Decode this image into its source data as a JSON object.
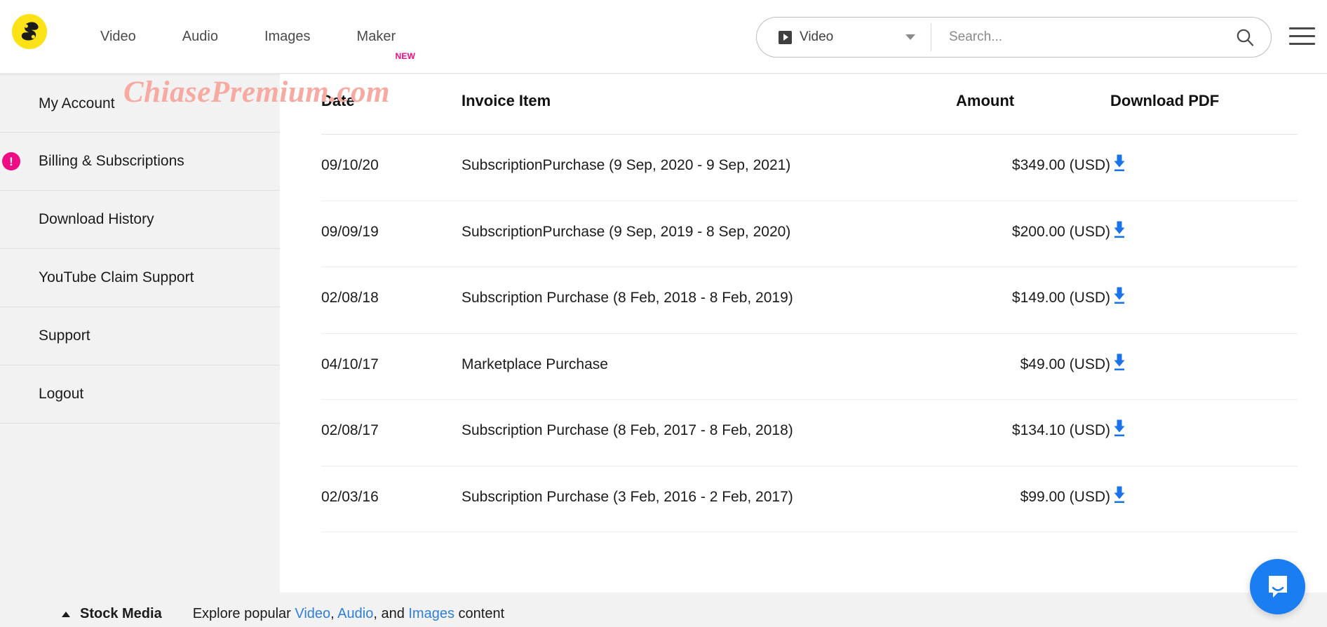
{
  "header": {
    "logo_name": "storyblocks-logo",
    "nav": [
      {
        "label": "Video",
        "badge": ""
      },
      {
        "label": "Audio",
        "badge": ""
      },
      {
        "label": "Images",
        "badge": ""
      },
      {
        "label": "Maker",
        "badge": "NEW"
      }
    ],
    "search": {
      "category_selected": "Video",
      "placeholder": "Search...",
      "search_icon": "search-icon",
      "caret_icon": "chevron-down-icon"
    },
    "menu_icon": "hamburger-menu-icon"
  },
  "watermark": {
    "text": "ChiasePremium.com",
    "color": "#f6aaa1"
  },
  "sidebar": {
    "items": [
      {
        "label": "My Account",
        "alert": ""
      },
      {
        "label": "Billing & Subscriptions",
        "alert": "!"
      },
      {
        "label": "Download History",
        "alert": ""
      },
      {
        "label": "YouTube Claim Support",
        "alert": ""
      },
      {
        "label": "Support",
        "alert": ""
      },
      {
        "label": "Logout",
        "alert": ""
      }
    ],
    "alert_color": "#ef0b84"
  },
  "invoices_table": {
    "columns": [
      "Date",
      "Invoice Item",
      "Amount",
      "Download PDF"
    ],
    "download_icon": "download-arrow-icon",
    "rows": [
      {
        "date": "09/10/20",
        "item": "SubscriptionPurchase (9 Sep, 2020 - 9 Sep, 2021)",
        "amount": "$349.00 (USD)"
      },
      {
        "date": "09/09/19",
        "item": "SubscriptionPurchase (9 Sep, 2019 - 8 Sep, 2020)",
        "amount": "$200.00 (USD)"
      },
      {
        "date": "02/08/18",
        "item": "Subscription Purchase (8 Feb, 2018 - 8 Feb, 2019)",
        "amount": "$149.00 (USD)"
      },
      {
        "date": "04/10/17",
        "item": "Marketplace Purchase",
        "amount": "$49.00 (USD)"
      },
      {
        "date": "02/08/17",
        "item": "Subscription Purchase (8 Feb, 2017 - 8 Feb, 2018)",
        "amount": "$134.10 (USD)"
      },
      {
        "date": "02/03/16",
        "item": "Subscription Purchase (3 Feb, 2016 - 2 Feb, 2017)",
        "amount": "$99.00 (USD)"
      }
    ]
  },
  "footer": {
    "title": "Stock Media",
    "desc_prefix": "Explore popular ",
    "link_video": "Video",
    "sep1": ", ",
    "link_audio": "Audio",
    "sep2": ", and ",
    "link_images": "Images",
    "desc_suffix": " content",
    "link_color": "#2f7fd6"
  },
  "chat": {
    "icon": "chat-bubble-icon",
    "color": "#1a7ef2"
  }
}
